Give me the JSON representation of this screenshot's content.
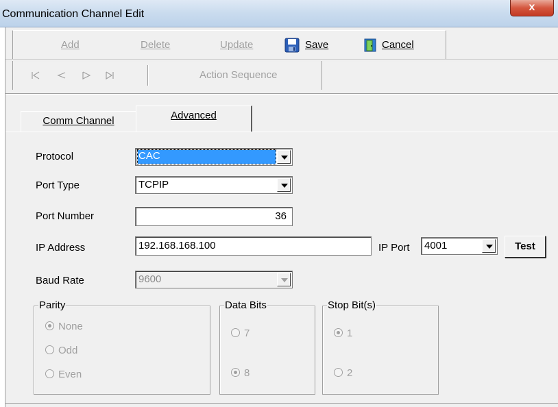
{
  "window": {
    "title": "Communication Channel Edit",
    "close_label": "x"
  },
  "toolbar": {
    "add_label": "Add",
    "delete_label": "Delete",
    "update_label": "Update",
    "save_label": "Save",
    "cancel_label": "Cancel",
    "action_sequence_label": "Action Sequence",
    "icons": [
      "first-record-icon",
      "previous-record-icon",
      "next-record-icon",
      "last-record-icon",
      "save-disk-icon",
      "cancel-door-icon"
    ]
  },
  "tabs": [
    {
      "label": "Comm Channel",
      "active": false
    },
    {
      "label": "Advanced",
      "active": true
    }
  ],
  "form": {
    "protocol_label": "Protocol",
    "protocol_value": "CAC",
    "port_type_label": "Port Type",
    "port_type_value": "TCPIP",
    "port_number_label": "Port Number",
    "port_number_value": "36",
    "ip_address_label": "IP Address",
    "ip_address_value": "192.168.168.100",
    "ip_port_label": "IP Port",
    "ip_port_value": "4001",
    "test_label": "Test",
    "baud_rate_label": "Baud Rate",
    "baud_rate_value": "9600"
  },
  "parity": {
    "legend": "Parity",
    "options": [
      {
        "label": "None",
        "selected": true
      },
      {
        "label": "Odd",
        "selected": false
      },
      {
        "label": "Even",
        "selected": false
      }
    ]
  },
  "data_bits": {
    "legend": "Data Bits",
    "options": [
      {
        "label": "7",
        "selected": false
      },
      {
        "label": "8",
        "selected": true
      }
    ]
  },
  "stop_bits": {
    "legend": "Stop Bit(s)",
    "options": [
      {
        "label": "1",
        "selected": true
      },
      {
        "label": "2",
        "selected": false
      }
    ]
  },
  "colors": {
    "selection": "#3399ff",
    "window_bg": "#f0f0f0",
    "disabled_text": "#a0a0a0"
  }
}
